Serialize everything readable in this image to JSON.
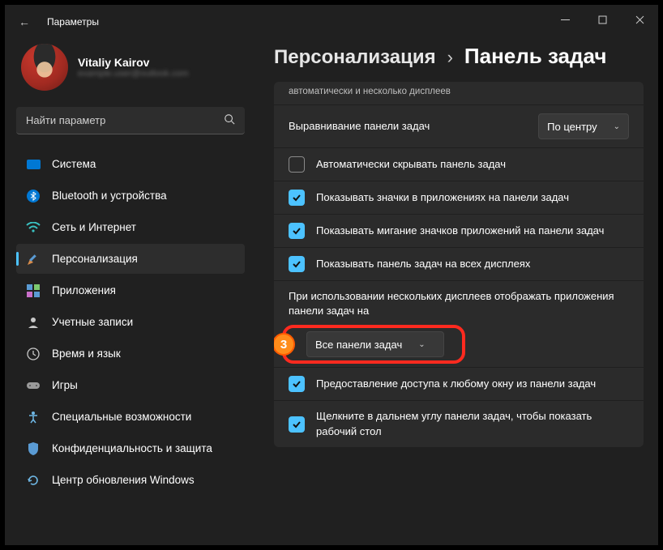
{
  "window": {
    "title": "Параметры"
  },
  "user": {
    "name": "Vitaliy Kairov",
    "email": "example.user@outlook.com"
  },
  "search": {
    "placeholder": "Найти параметр"
  },
  "nav": {
    "items": [
      {
        "label": "Система"
      },
      {
        "label": "Bluetooth и устройства"
      },
      {
        "label": "Сеть и Интернет"
      },
      {
        "label": "Персонализация"
      },
      {
        "label": "Приложения"
      },
      {
        "label": "Учетные записи"
      },
      {
        "label": "Время и язык"
      },
      {
        "label": "Игры"
      },
      {
        "label": "Специальные возможности"
      },
      {
        "label": "Конфиденциальность и защита"
      },
      {
        "label": "Центр обновления Windows"
      }
    ]
  },
  "breadcrumb": {
    "parent": "Персонализация",
    "current": "Панель задач"
  },
  "panel": {
    "truncated_top": "автоматически и несколько дисплеев",
    "alignment": {
      "label": "Выравнивание панели задач",
      "value": "По центру"
    },
    "autohide": {
      "label": "Автоматически скрывать панель задач"
    },
    "show_badges": {
      "label": "Показывать значки в приложениях на панели задач"
    },
    "show_flashing": {
      "label": "Показывать мигание значков приложений на панели задач"
    },
    "show_all_displays": {
      "label": "Показывать панель задач на всех дисплеях"
    },
    "multi_display_prompt": "При использовании нескольких дисплеев отображать приложения панели задач на",
    "multi_display_value": "Все панели задач",
    "badge_number": "3",
    "any_window_access": {
      "label": "Предоставление доступа к любому окну из панели задач"
    },
    "far_corner": {
      "label": "Щелкните в дальнем углу панели задач, чтобы показать рабочий стол"
    }
  }
}
